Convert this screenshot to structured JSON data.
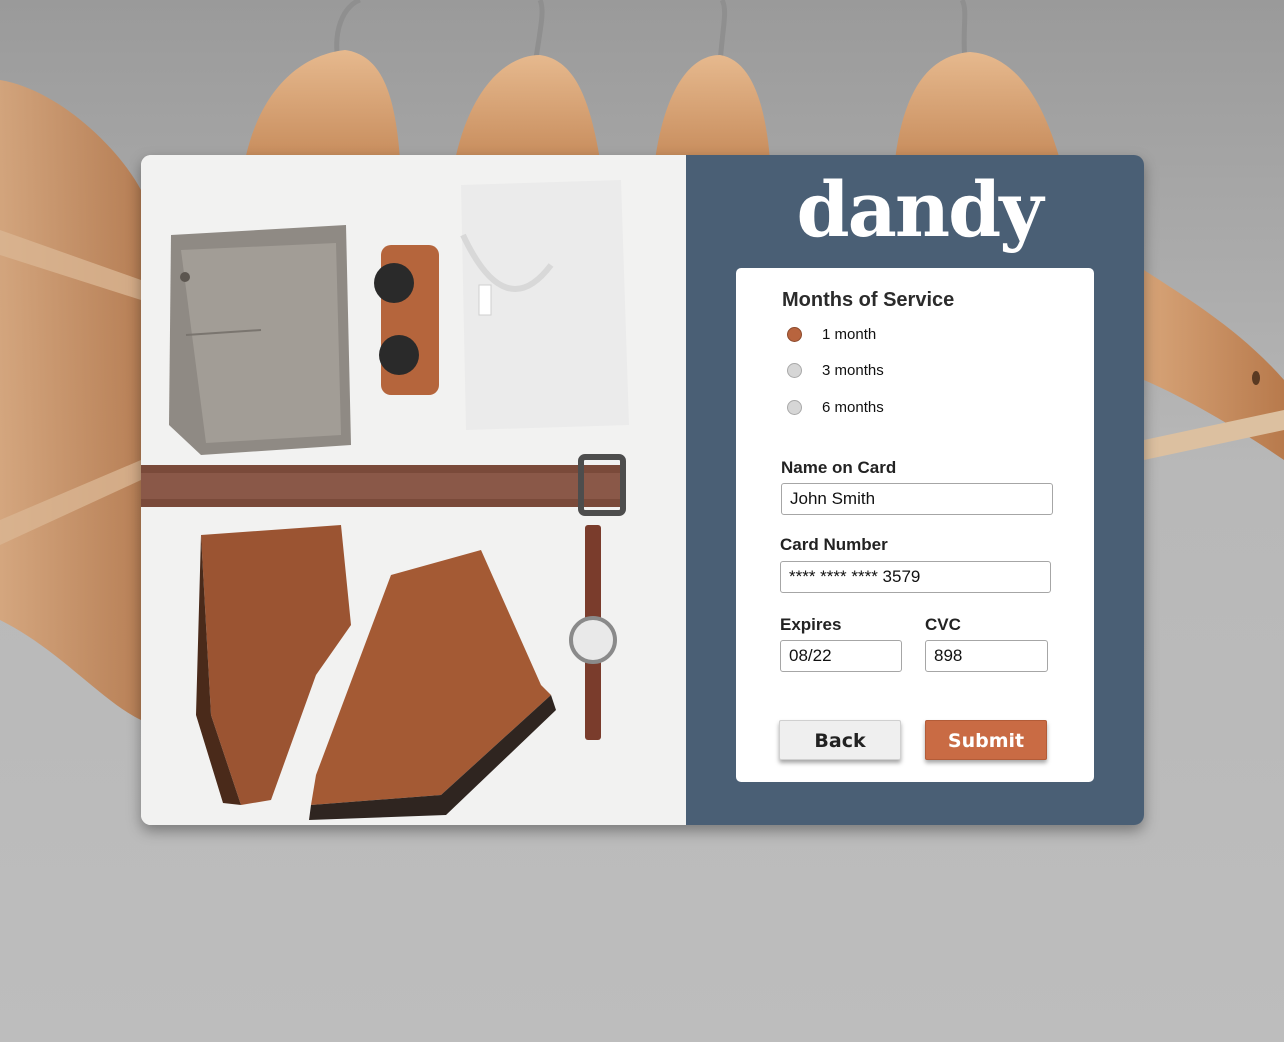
{
  "brand": {
    "logo_text": "dandy"
  },
  "form": {
    "months_title": "Months of Service",
    "plans": [
      {
        "label": "1 month",
        "selected": true
      },
      {
        "label": "3 months",
        "selected": false
      },
      {
        "label": "6 months",
        "selected": false
      }
    ],
    "name_label": "Name on Card",
    "name_value": "John Smith",
    "card_label": "Card Number",
    "card_value": "**** **** **** 3579",
    "expires_label": "Expires",
    "expires_value": "08/22",
    "cvc_label": "CVC",
    "cvc_value": "898",
    "back_label": "Back",
    "submit_label": "Submit"
  },
  "colors": {
    "panel": "#4a5f75",
    "accent": "#c96b44",
    "radio_selected": "#b8643e"
  }
}
